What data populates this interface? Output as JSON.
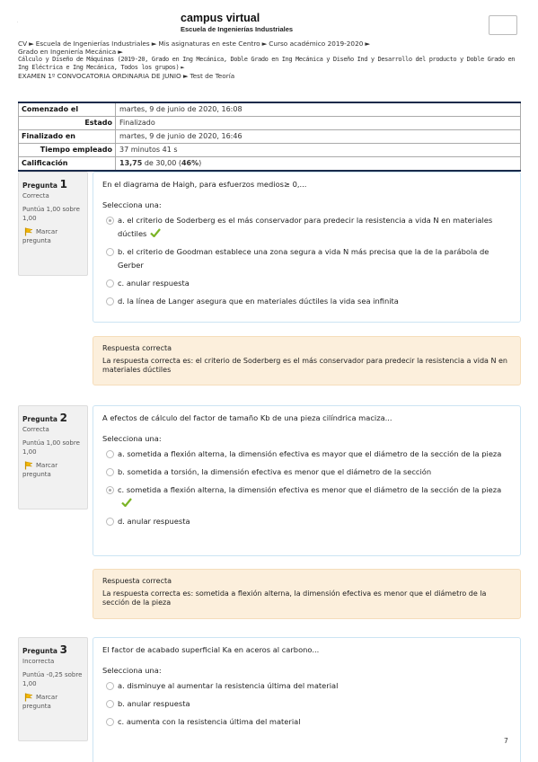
{
  "header": {
    "logo_dot": "·",
    "site_title": "campus virtual",
    "site_subtitle": "Escuela de Ingenierías Industriales"
  },
  "breadcrumb": {
    "line1": [
      "CV",
      "Escuela de Ingenierías Industriales",
      "Mis asignaturas en este Centro",
      "Curso académico 2019-2020"
    ],
    "line2": [
      "Grado en Ingeniería Mecánica"
    ],
    "line3": "Cálculo y Diseño de Máquinas (2019-20, Grado en Ing Mecánica, Doble Grado en Ing Mecánica y Diseño Ind y Desarrollo del producto y Doble Grado en Ing Eléctrica e Ing Mecánica, Todos los grupos)",
    "line4": [
      "EXAMEN 1º CONVOCATORIA ORDINARIA DE JUNIO",
      "Test de Teoría"
    ]
  },
  "summary": {
    "started_label": "Comenzado el",
    "started_value": "martes, 9 de junio de 2020, 16:08",
    "state_label": "Estado",
    "state_value": "Finalizado",
    "finished_label": "Finalizado en",
    "finished_value": "martes, 9 de junio de 2020, 16:46",
    "time_label": "Tiempo empleado",
    "time_value": "37 minutos 41 s",
    "grade_label": "Calificación",
    "grade_score": "13,75",
    "grade_rest": " de 30,00 (",
    "grade_pct": "46%",
    "grade_close": ")"
  },
  "questions": [
    {
      "label": "Pregunta",
      "number": "1",
      "state": "Correcta",
      "grade": "Puntúa 1,00 sobre 1,00",
      "flag": "Marcar pregunta",
      "text": "En el diagrama de Haigh, para esfuerzos medios≥ 0,...",
      "prompt": "Selecciona una:",
      "options": [
        "a. el criterio de Soderberg es el más conservador para predecir la resistencia a vida N en materiales dúctiles",
        "b. el criterio de Goodman establece una zona segura a vida N más precisa que la de la parábola de Gerber",
        "c. anular respuesta",
        "d. la línea de Langer asegura que en materiales dúctiles la vida sea infinita"
      ],
      "feedback_title": "Respuesta correcta",
      "feedback_text": "La respuesta correcta es: el criterio de Soderberg es el más conservador para predecir la resistencia a vida N en materiales dúctiles"
    },
    {
      "label": "Pregunta",
      "number": "2",
      "state": "Correcta",
      "grade": "Puntúa 1,00 sobre 1,00",
      "flag": "Marcar pregunta",
      "text": "A efectos de cálculo del factor de tamaño Kb de una pieza cilíndrica maciza...",
      "prompt": "Selecciona una:",
      "options": [
        "a. sometida a flexión alterna, la dimensión efectiva es mayor que el diámetro de la sección de la pieza",
        "b. sometida a torsión, la dimensión efectiva es menor que el diámetro de la sección",
        "c. sometida a flexión alterna, la dimensión efectiva es menor que el diámetro de la sección de la pieza",
        "d. anular respuesta"
      ],
      "feedback_title": "Respuesta correcta",
      "feedback_text": "La respuesta correcta es: sometida a flexión alterna, la dimensión efectiva es menor que el diámetro de la sección de la pieza"
    },
    {
      "label": "Pregunta",
      "number": "3",
      "state": "Incorrecta",
      "grade": "Puntúa -0,25 sobre 1,00",
      "flag": "Marcar pregunta",
      "text": "El factor de acabado superficial Ka en aceros al carbono...",
      "prompt": "Selecciona una:",
      "options": [
        "a. disminuye al aumentar la resistencia última del material",
        "b. anular respuesta",
        "c. aumenta con la resistencia última del material"
      ]
    }
  ],
  "page_number": "7",
  "colors": {
    "accent_border": "#cce4f3",
    "feedback_bg": "#fcefdc",
    "tick_green": "#7bb426",
    "flag_yellow": "#f5b800"
  }
}
